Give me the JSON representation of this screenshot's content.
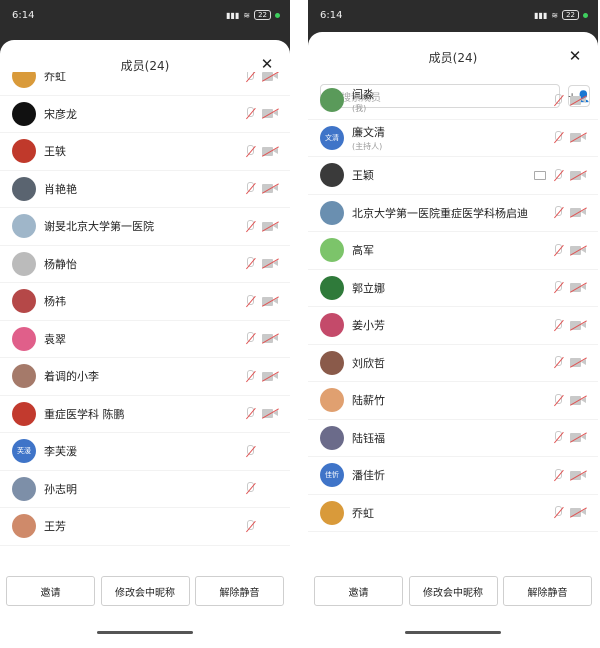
{
  "left": {
    "status": {
      "time": "6:14",
      "battery": "22"
    },
    "title": "成员(24)",
    "members": [
      {
        "name": "乔虹",
        "color": "#d99a3a",
        "screen": false,
        "cam": true
      },
      {
        "name": "宋彦龙",
        "color": "#111111",
        "screen": false,
        "cam": true
      },
      {
        "name": "王轶",
        "color": "#c0392b",
        "screen": false,
        "cam": true
      },
      {
        "name": "肖艳艳",
        "color": "#5a6470",
        "screen": false,
        "cam": true
      },
      {
        "name": "谢旻北京大学第一医院",
        "color": "#9fb6c9",
        "screen": false,
        "cam": true
      },
      {
        "name": "杨静怡",
        "color": "#bbbbbb",
        "screen": false,
        "cam": true
      },
      {
        "name": "杨祎",
        "color": "#b54848",
        "screen": false,
        "cam": true
      },
      {
        "name": "袁翠",
        "color": "#e05f8a",
        "screen": false,
        "cam": true
      },
      {
        "name": "着调的小李",
        "color": "#a57a6a",
        "screen": false,
        "cam": true
      },
      {
        "name": "重症医学科 陈鹏",
        "color": "#c23a2e",
        "screen": false,
        "cam": true
      },
      {
        "name": "李芙湲",
        "color": "#3f74c8",
        "avatar_text": "芙湲",
        "screen": false,
        "cam": false
      },
      {
        "name": "孙志明",
        "color": "#7d8fa8",
        "screen": false,
        "cam": false
      },
      {
        "name": "王芳",
        "color": "#cf8a6a",
        "screen": false,
        "cam": false
      }
    ],
    "buttons": {
      "invite": "邀请",
      "rename": "修改会中昵称",
      "unmute": "解除静音"
    }
  },
  "right": {
    "status": {
      "time": "6:14",
      "battery": "22"
    },
    "title": "成员(24)",
    "search_placeholder": "搜索成员",
    "members": [
      {
        "name": "闫淼",
        "role": "(我)",
        "color": "#5a9a5a",
        "screen": false,
        "cam": true
      },
      {
        "name": "廉文清",
        "role": "(主持人)",
        "color": "#3f74c8",
        "avatar_text": "文清",
        "screen": false,
        "cam": true
      },
      {
        "name": "王颖",
        "color": "#3a3a3a",
        "screen": true,
        "cam": true
      },
      {
        "name": "北京大学第一医院重症医学科杨启迪",
        "color": "#6a8fb0",
        "screen": false,
        "cam": true
      },
      {
        "name": "高军",
        "color": "#7cc46a",
        "screen": false,
        "cam": true
      },
      {
        "name": "郭立娜",
        "color": "#2f7a3a",
        "screen": false,
        "cam": true
      },
      {
        "name": "姜小芳",
        "color": "#c44a6a",
        "screen": false,
        "cam": true
      },
      {
        "name": "刘欣哲",
        "color": "#8a5a4a",
        "screen": false,
        "cam": true
      },
      {
        "name": "陆薪竹",
        "color": "#e0a070",
        "screen": false,
        "cam": true
      },
      {
        "name": "陆钰福",
        "color": "#6b6b8a",
        "screen": false,
        "cam": true
      },
      {
        "name": "潘佳忻",
        "color": "#3f74c8",
        "avatar_text": "佳忻",
        "screen": false,
        "cam": true
      },
      {
        "name": "乔虹",
        "color": "#d99a3a",
        "screen": false,
        "cam": true
      }
    ],
    "buttons": {
      "invite": "邀请",
      "rename": "修改会中昵称",
      "unmute": "解除静音"
    }
  }
}
